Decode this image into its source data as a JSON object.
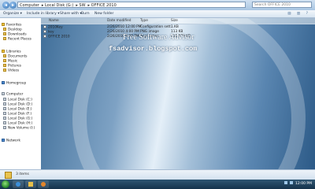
{
  "address_bar": {
    "crumbs": [
      "Computer",
      "Local Disk (G:)",
      "SW",
      "OFFICE 2010"
    ],
    "search_placeholder": "Search OFFICE 2010"
  },
  "toolbar": {
    "organize": "Organize ▾",
    "include_in_library": "Include in library ▾",
    "share_with": "Share with ▾",
    "burn": "Burn",
    "new_folder": "New folder"
  },
  "sidebar": {
    "favorites": "Favorites",
    "favorite_items": [
      "Desktop",
      "Downloads",
      "Recent Places"
    ],
    "libraries": "Libraries",
    "library_items": [
      "Documents",
      "Music",
      "Pictures",
      "Videos"
    ],
    "homegroup": "Homegroup",
    "computer": "Computer",
    "drives": [
      "Local Disk (C:)",
      "Local Disk (D:)",
      "Local Disk (E:)",
      "Local Disk (F:)",
      "Local Disk (G:)",
      "Local Disk (H:)",
      "New Volume (I:)"
    ],
    "network": "Network"
  },
  "columns": {
    "name": "Name",
    "date_modified": "Date modified",
    "type": "Type",
    "size": "Size"
  },
  "files": [
    {
      "name": "2010Key",
      "date": "2/26/2010 12:00 PM",
      "type": "Configuration sett...",
      "size": "1 KB"
    },
    {
      "name": "key",
      "date": "2/26/2010 4:00 PM",
      "type": "PNG image",
      "size": "113 KB"
    },
    {
      "name": "OFFICE 2010",
      "date": "2/26/2010 6:09 PM",
      "type": "Application",
      "size": "411,079 KB"
    }
  ],
  "overlay": {
    "title": "Free Software Advisor",
    "url": "fsadvisor.blogspot.com"
  },
  "details": {
    "count": "3 items"
  },
  "taskbar": {
    "time": "12:00 PM"
  }
}
